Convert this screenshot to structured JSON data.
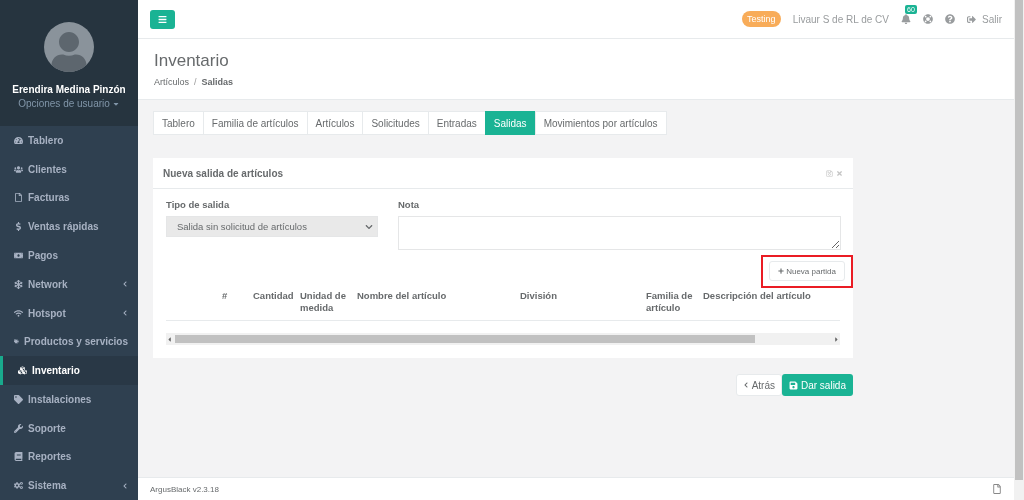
{
  "sidebar": {
    "user_name": "Erendira Medina Pinzón",
    "user_options": "Opciones de usuario",
    "items": [
      {
        "label": "Tablero",
        "submenu": false,
        "selected": false
      },
      {
        "label": "Clientes",
        "submenu": false,
        "selected": false
      },
      {
        "label": "Facturas",
        "submenu": false,
        "selected": false
      },
      {
        "label": "Ventas rápidas",
        "submenu": false,
        "selected": false
      },
      {
        "label": "Pagos",
        "submenu": false,
        "selected": false
      },
      {
        "label": "Network",
        "submenu": true,
        "selected": false
      },
      {
        "label": "Hotspot",
        "submenu": true,
        "selected": false
      },
      {
        "label": "Productos y servicios",
        "submenu": false,
        "selected": false
      },
      {
        "label": "Inventario",
        "submenu": false,
        "selected": true
      },
      {
        "label": "Instalaciones",
        "submenu": false,
        "selected": false
      },
      {
        "label": "Soporte",
        "submenu": false,
        "selected": false
      },
      {
        "label": "Reportes",
        "submenu": false,
        "selected": false
      },
      {
        "label": "Sistema",
        "submenu": true,
        "selected": false
      }
    ]
  },
  "topbar": {
    "badge": "Testing",
    "company": "Livaur S de RL de CV",
    "notifications": "60",
    "logout": "Salir"
  },
  "header": {
    "title": "Inventario",
    "breadcrumb": [
      "Artículos",
      "Salidas"
    ],
    "separator": "/"
  },
  "tabs": [
    {
      "label": "Tablero",
      "selected": false
    },
    {
      "label": "Familia de artículos",
      "selected": false
    },
    {
      "label": "Artículos",
      "selected": false
    },
    {
      "label": "Solicitudes",
      "selected": false
    },
    {
      "label": "Entradas",
      "selected": false
    },
    {
      "label": "Salidas",
      "selected": true
    },
    {
      "label": "Movimientos por artículos",
      "selected": false
    }
  ],
  "panel": {
    "title": "Nueva salida de artículos",
    "type_label": "Tipo de salida",
    "type_value": "Salida sin solicitud de artículos",
    "note_label": "Nota",
    "add_button": {
      "label": "Nueva partida",
      "highlighted": true
    },
    "table": {
      "columns": [
        "#",
        "Cantidad",
        "Unidad de medida",
        "Nombre del artículo",
        "División",
        "Familia de artículo",
        "Descripción del artículo"
      ]
    }
  },
  "actions": {
    "back": "Atrás",
    "submit": "Dar salida"
  },
  "footer": {
    "version": "ArgusBlack v2.3.18"
  }
}
